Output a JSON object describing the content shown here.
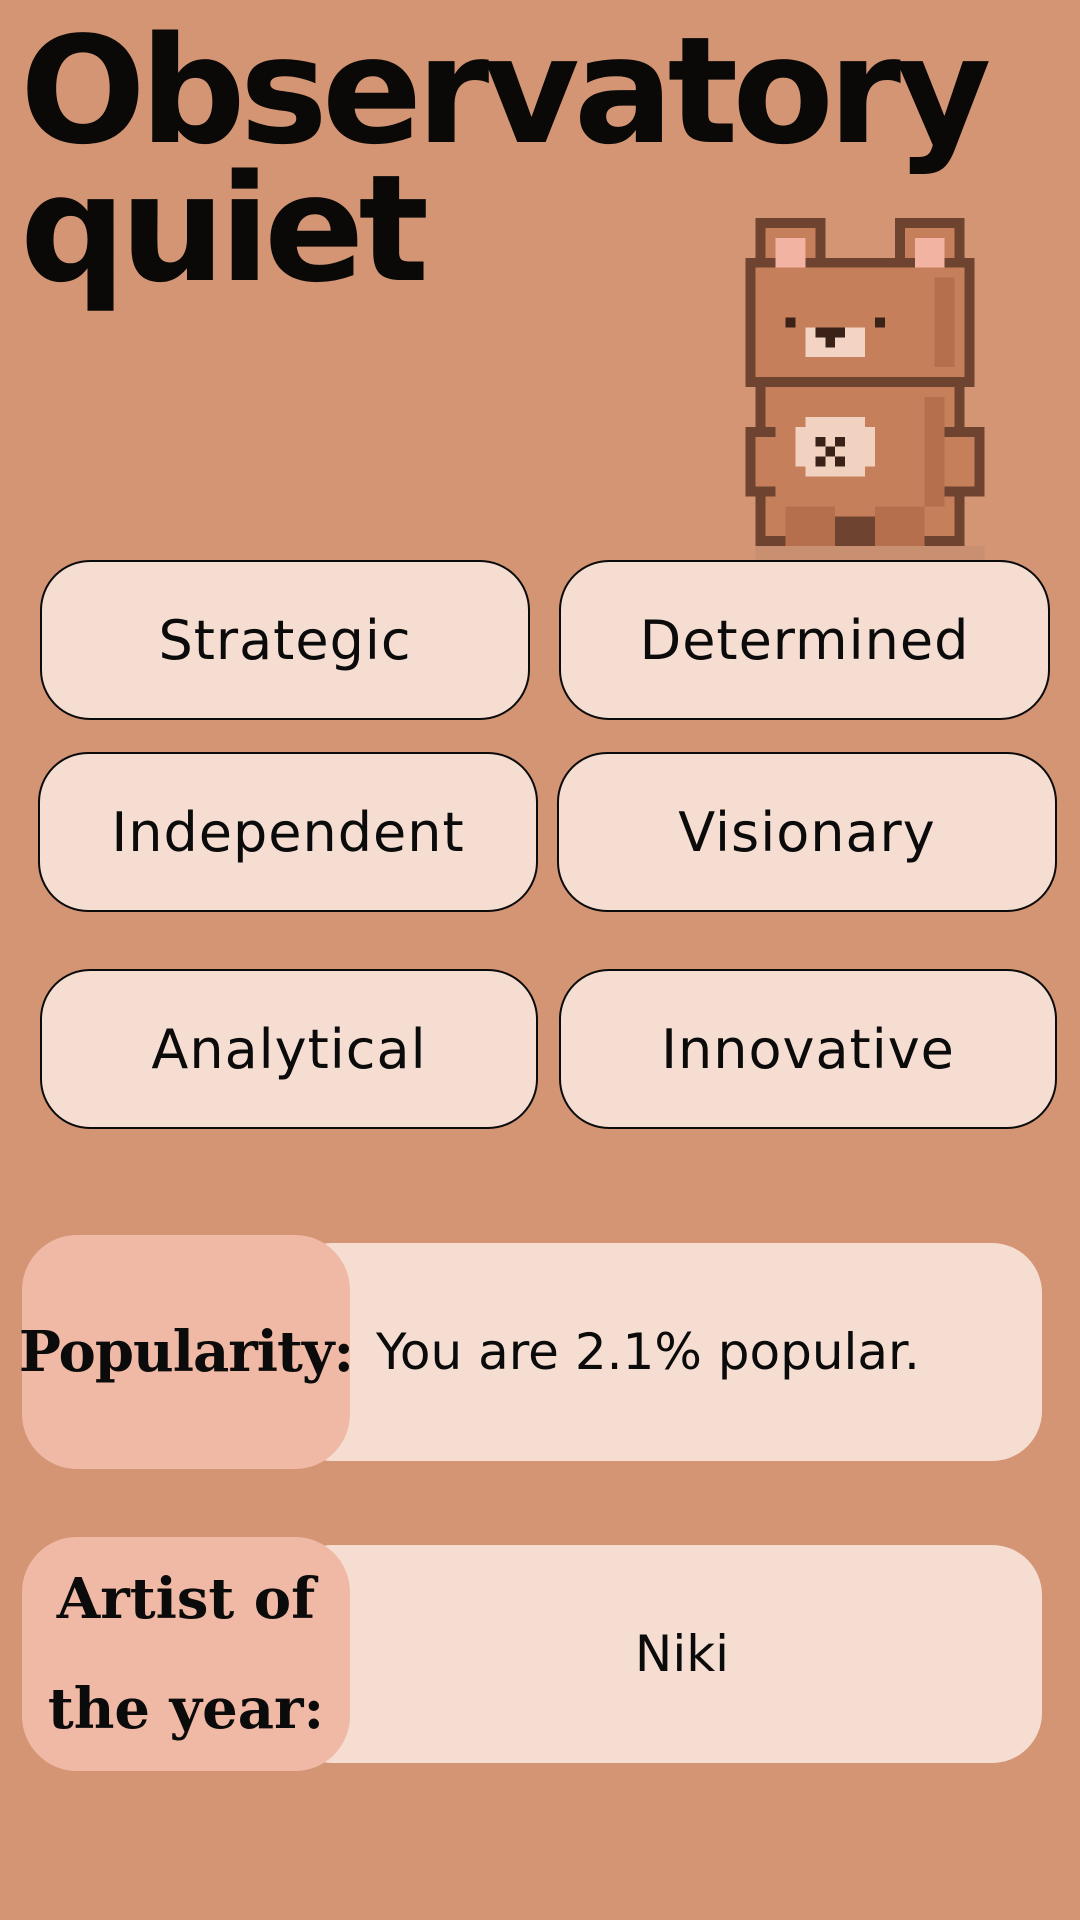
{
  "header": {
    "title_line1": "Observatory",
    "title_line2": "quiet"
  },
  "mascot": {
    "icon": "pixel-bear-icon"
  },
  "traits": [
    "Strategic",
    "Determined",
    "Independent",
    "Visionary",
    "Analytical",
    "Innovative"
  ],
  "popularity": {
    "label": "Popularity:",
    "value": "You are 2.1% popular."
  },
  "artist": {
    "label_line1": "Artist of",
    "label_line2": "the year:",
    "value": "Niki"
  },
  "colors": {
    "background": "#d39574",
    "pill": "#f5ddd1",
    "label_box": "#f0b9a5",
    "text": "#0b0b0b"
  }
}
